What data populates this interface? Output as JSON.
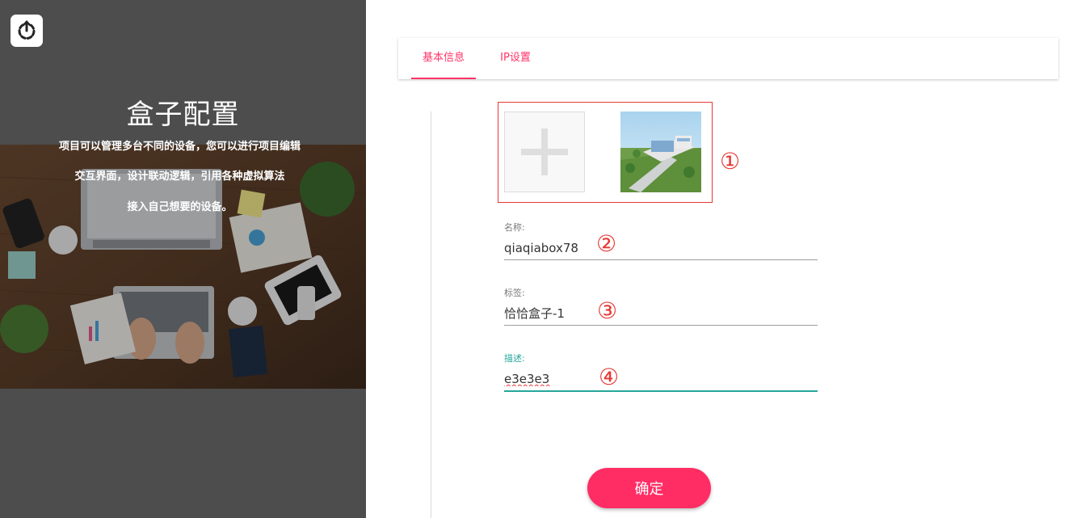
{
  "left": {
    "title": "盒子配置",
    "desc_lines": [
      "项目可以管理多台不同的设备，您可以进行项目编辑",
      "交互界面，设计联动逻辑，引用各种虚拟算法",
      "接入自己想要的设备。"
    ]
  },
  "tabs": [
    {
      "label": "基本信息",
      "active": true
    },
    {
      "label": "IP设置",
      "active": false
    }
  ],
  "markers": [
    "①",
    "②",
    "③",
    "④"
  ],
  "form": {
    "name": {
      "label": "名称:",
      "value": "qiaqiabox78"
    },
    "tag": {
      "label": "标签:",
      "value": "恰恰盒子-1"
    },
    "desc": {
      "label": "描述:",
      "value": "e3e3e3"
    }
  },
  "confirm_label": "确定",
  "colors": {
    "accent": "#ff3366",
    "button": "#ff2d64",
    "focus": "#26a69a",
    "marker": "#e53935",
    "left_bg": "#4d4d4d"
  },
  "icons": {
    "back": "refresh-icon",
    "add": "plus-icon"
  }
}
